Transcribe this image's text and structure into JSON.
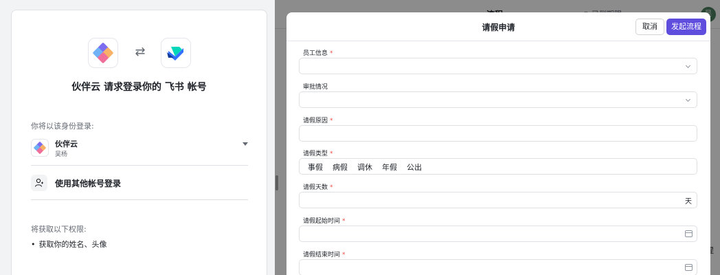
{
  "auth": {
    "title": "伙伴云 请求登录你的 飞书 帐号",
    "login_as_label": "你将以该身份登录:",
    "account": {
      "name": "伙伴云",
      "user": "吴杨"
    },
    "other_login_label": "使用其他帐号登录",
    "permissions_title": "将获取以下权限:",
    "permissions": [
      "获取你的姓名、头像"
    ],
    "swap_glyph": "⇄"
  },
  "background_app": {
    "header_title": "流程",
    "header_link": "◎ 已到期限",
    "avatar_initial": "吴",
    "side_chars": [
      "提",
      "?"
    ]
  },
  "modal": {
    "title": "请假申请",
    "cancel_label": "取消",
    "submit_label": "发起流程",
    "accent_color": "#5f4dde",
    "fields": [
      {
        "label": "员工信息",
        "required": "*",
        "type": "select"
      },
      {
        "label": "审批情况",
        "required": "",
        "type": "select"
      },
      {
        "label": "请假原因",
        "required": "*",
        "type": "text"
      },
      {
        "label": "请假类型",
        "required": "*",
        "type": "radio",
        "options": [
          "事假",
          "病假",
          "调休",
          "年假",
          "公出"
        ]
      },
      {
        "label": "请假天数",
        "required": "*",
        "type": "number",
        "suffix": "天"
      },
      {
        "label": "请假起始时间",
        "required": "*",
        "type": "date"
      },
      {
        "label": "请假结束时间",
        "required": "*",
        "type": "date"
      }
    ]
  }
}
